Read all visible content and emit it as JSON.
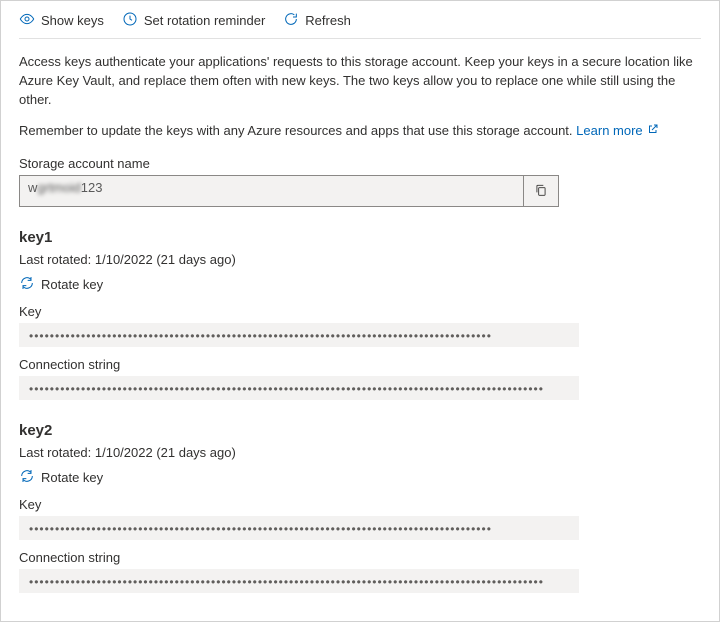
{
  "toolbar": {
    "show_keys": "Show keys",
    "set_rotation": "Set rotation reminder",
    "refresh": "Refresh"
  },
  "intro": "Access keys authenticate your applications' requests to this storage account. Keep your keys in a secure location like Azure Key Vault, and replace them often with new keys. The two keys allow you to replace one while still using the other.",
  "intro2": "Remember to update the keys with any Azure resources and apps that use this storage account.",
  "learn_more": "Learn more",
  "storage_account_name_label": "Storage account name",
  "storage_account_name_prefix": "w",
  "storage_account_name_blurred": "grtmoid",
  "storage_account_name_suffix": "123",
  "key1": {
    "heading": "key1",
    "last_rotated": "Last rotated: 1/10/2022 (21 days ago)",
    "rotate_label": "Rotate key",
    "key_label": "Key",
    "key_masked": "•••••••••••••••••••••••••••••••••••••••••••••••••••••••••••••••••••••••••••••••••••••••••",
    "conn_label": "Connection string",
    "conn_masked": "•••••••••••••••••••••••••••••••••••••••••••••••••••••••••••••••••••••••••••••••••••••••••••••••••••"
  },
  "key2": {
    "heading": "key2",
    "last_rotated": "Last rotated: 1/10/2022 (21 days ago)",
    "rotate_label": "Rotate key",
    "key_label": "Key",
    "key_masked": "•••••••••••••••••••••••••••••••••••••••••••••••••••••••••••••••••••••••••••••••••••••••••",
    "conn_label": "Connection string",
    "conn_masked": "•••••••••••••••••••••••••••••••••••••••••••••••••••••••••••••••••••••••••••••••••••••••••••••••••••"
  }
}
